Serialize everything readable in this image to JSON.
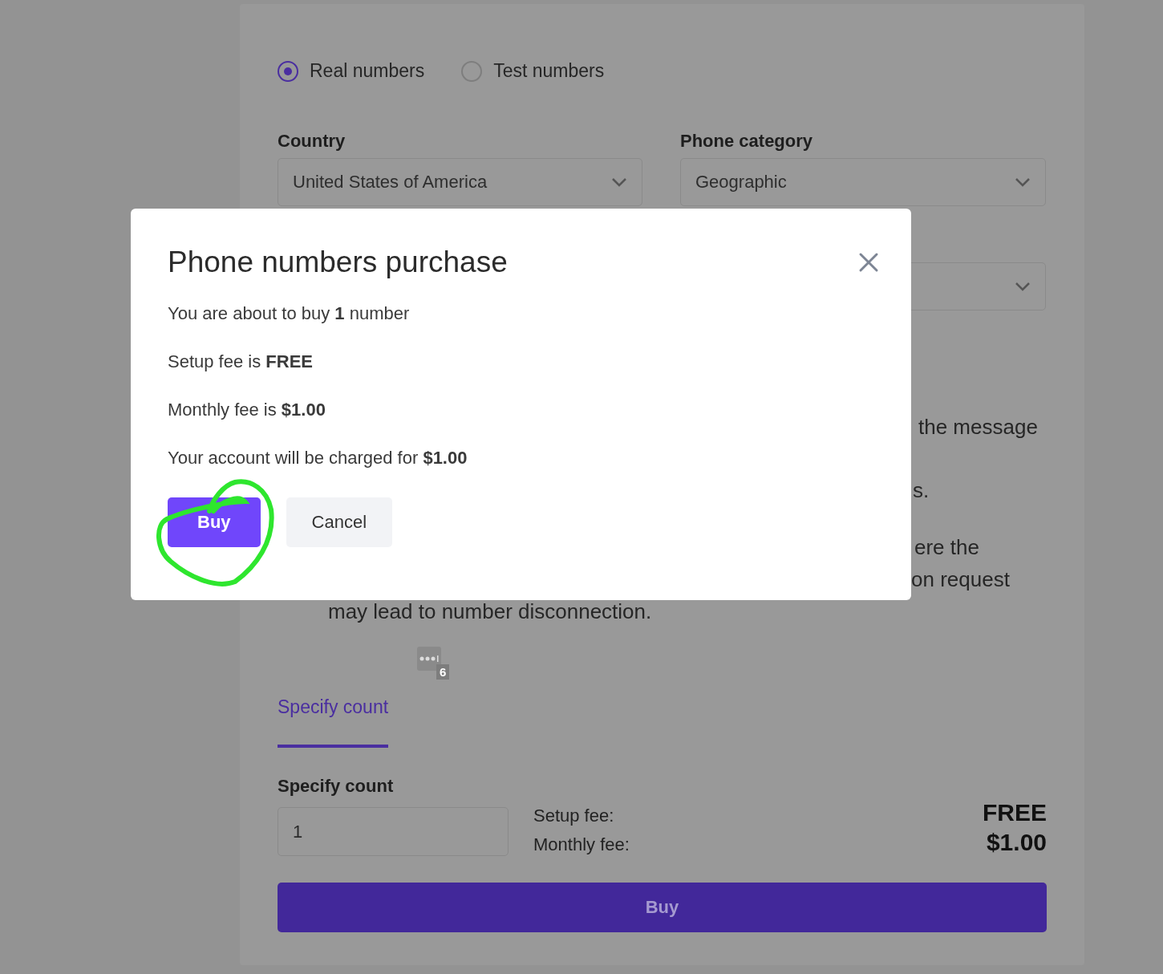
{
  "number_type": [
    {
      "label": "Real numbers",
      "selected": true
    },
    {
      "label": "Test numbers",
      "selected": false
    }
  ],
  "country": {
    "label": "Country",
    "value": "United States of America"
  },
  "phone_category": {
    "label": "Phone category",
    "value": "Geographic"
  },
  "notes_partial": [
    "the message",
    "s.",
    "ere the",
    "on request",
    "may lead to number disconnection."
  ],
  "extension_badge": {
    "count": "6"
  },
  "tabs": [
    {
      "label": "Specify count",
      "selected": true
    }
  ],
  "count": {
    "label": "Specify count",
    "value": "1"
  },
  "fees": [
    {
      "label": "Setup fee:",
      "value": "FREE"
    },
    {
      "label": "Monthly fee:",
      "value": "$1.00"
    }
  ],
  "buy_button": "Buy",
  "dialog": {
    "title": "Phone numbers purchase",
    "lines": [
      "You are about to buy **1** number",
      "Setup fee is **FREE**",
      "Monthly fee is **$1.00**",
      "Your account will be charged for **$1.00**"
    ],
    "buttons": [
      {
        "label": "Buy",
        "kind": "primary"
      },
      {
        "label": "Cancel",
        "kind": "secondary"
      }
    ]
  }
}
